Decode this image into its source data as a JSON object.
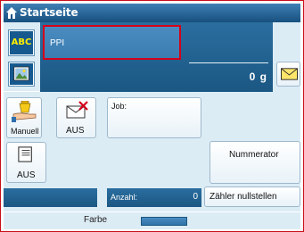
{
  "header": {
    "title": "Startseite",
    "home_icon": "home-icon"
  },
  "left": {
    "abc_label": "ABC",
    "image_icon": "image-icon"
  },
  "main": {
    "text_field_value": "PPI",
    "weight_value": "0 g",
    "envelope_icon": "envelope-icon"
  },
  "tiles": {
    "manuell_label": "Manuell",
    "aus_label_1": "AUS",
    "aus_label_2": "AUS",
    "job_label": "Job:",
    "nummerator_label": "Nummerator",
    "anzahl_label": "Anzahl:",
    "anzahl_value": "0",
    "reset_label": "Zähler nullstellen"
  },
  "status": {
    "farbe_label": "Farbe"
  },
  "colors": {
    "highlight_border": "#d4001a",
    "accent_blue": "#1b5783",
    "panel": "#dcecf5"
  }
}
